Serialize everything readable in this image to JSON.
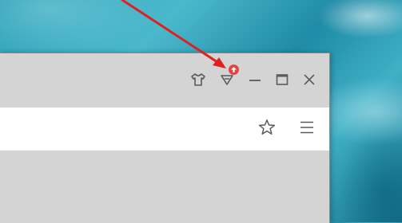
{
  "desktop": {
    "wallpaper": "water"
  },
  "browser": {
    "titlebar": {
      "buttons": [
        {
          "name": "skin",
          "icon": "tshirt-icon"
        },
        {
          "name": "downloads",
          "icon": "triangle-down-icon",
          "badge_icon": "up-arrow-icon",
          "badge_color": "#e94040"
        },
        {
          "name": "minimize",
          "icon": "minimize-icon"
        },
        {
          "name": "maximize",
          "icon": "maximize-icon"
        },
        {
          "name": "close",
          "icon": "close-icon"
        }
      ]
    },
    "addressbar": {
      "url": "",
      "buttons": [
        {
          "name": "bookmark",
          "icon": "star-icon"
        },
        {
          "name": "menu",
          "icon": "hamburger-menu-icon"
        }
      ]
    }
  },
  "annotation": {
    "color": "#e02020",
    "type": "arrow"
  },
  "colors": {
    "window_gray": "#d4d4d4",
    "icon_gray": "#5a5a5a",
    "addressbar_bg": "#ffffff"
  }
}
